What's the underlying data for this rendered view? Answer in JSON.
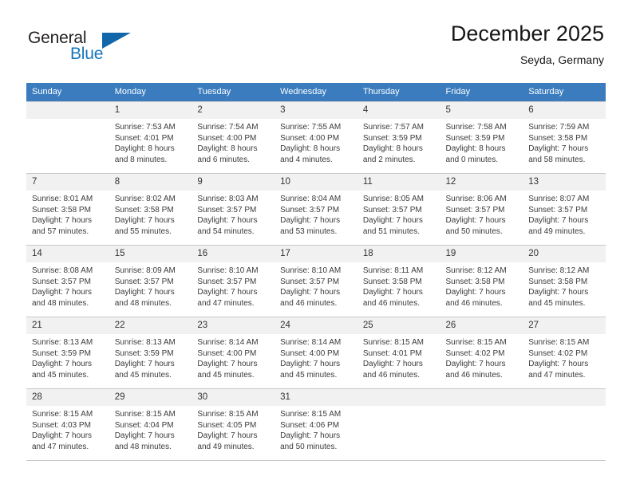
{
  "brand": {
    "name_part1": "General",
    "name_part2": "Blue",
    "triangle_icon": "triangle-icon",
    "color_dark": "#231f20",
    "color_blue": "#1476bc"
  },
  "header": {
    "title": "December 2025",
    "subtitle": "Seyda, Germany"
  },
  "theme": {
    "header_bg": "#3a7cbe",
    "daynum_bg": "#f1f1f1",
    "grid_line": "#c8c8c8",
    "text": "#3b3b3b"
  },
  "weekdays": [
    "Sunday",
    "Monday",
    "Tuesday",
    "Wednesday",
    "Thursday",
    "Friday",
    "Saturday"
  ],
  "weeks": [
    [
      {
        "day": "",
        "empty": true,
        "sunrise": "",
        "sunset": "",
        "daylight_line1": "",
        "daylight_line2": ""
      },
      {
        "day": "1",
        "sunrise": "Sunrise: 7:53 AM",
        "sunset": "Sunset: 4:01 PM",
        "daylight_line1": "Daylight: 8 hours",
        "daylight_line2": "and 8 minutes."
      },
      {
        "day": "2",
        "sunrise": "Sunrise: 7:54 AM",
        "sunset": "Sunset: 4:00 PM",
        "daylight_line1": "Daylight: 8 hours",
        "daylight_line2": "and 6 minutes."
      },
      {
        "day": "3",
        "sunrise": "Sunrise: 7:55 AM",
        "sunset": "Sunset: 4:00 PM",
        "daylight_line1": "Daylight: 8 hours",
        "daylight_line2": "and 4 minutes."
      },
      {
        "day": "4",
        "sunrise": "Sunrise: 7:57 AM",
        "sunset": "Sunset: 3:59 PM",
        "daylight_line1": "Daylight: 8 hours",
        "daylight_line2": "and 2 minutes."
      },
      {
        "day": "5",
        "sunrise": "Sunrise: 7:58 AM",
        "sunset": "Sunset: 3:59 PM",
        "daylight_line1": "Daylight: 8 hours",
        "daylight_line2": "and 0 minutes."
      },
      {
        "day": "6",
        "sunrise": "Sunrise: 7:59 AM",
        "sunset": "Sunset: 3:58 PM",
        "daylight_line1": "Daylight: 7 hours",
        "daylight_line2": "and 58 minutes."
      }
    ],
    [
      {
        "day": "7",
        "sunrise": "Sunrise: 8:01 AM",
        "sunset": "Sunset: 3:58 PM",
        "daylight_line1": "Daylight: 7 hours",
        "daylight_line2": "and 57 minutes."
      },
      {
        "day": "8",
        "sunrise": "Sunrise: 8:02 AM",
        "sunset": "Sunset: 3:58 PM",
        "daylight_line1": "Daylight: 7 hours",
        "daylight_line2": "and 55 minutes."
      },
      {
        "day": "9",
        "sunrise": "Sunrise: 8:03 AM",
        "sunset": "Sunset: 3:57 PM",
        "daylight_line1": "Daylight: 7 hours",
        "daylight_line2": "and 54 minutes."
      },
      {
        "day": "10",
        "sunrise": "Sunrise: 8:04 AM",
        "sunset": "Sunset: 3:57 PM",
        "daylight_line1": "Daylight: 7 hours",
        "daylight_line2": "and 53 minutes."
      },
      {
        "day": "11",
        "sunrise": "Sunrise: 8:05 AM",
        "sunset": "Sunset: 3:57 PM",
        "daylight_line1": "Daylight: 7 hours",
        "daylight_line2": "and 51 minutes."
      },
      {
        "day": "12",
        "sunrise": "Sunrise: 8:06 AM",
        "sunset": "Sunset: 3:57 PM",
        "daylight_line1": "Daylight: 7 hours",
        "daylight_line2": "and 50 minutes."
      },
      {
        "day": "13",
        "sunrise": "Sunrise: 8:07 AM",
        "sunset": "Sunset: 3:57 PM",
        "daylight_line1": "Daylight: 7 hours",
        "daylight_line2": "and 49 minutes."
      }
    ],
    [
      {
        "day": "14",
        "sunrise": "Sunrise: 8:08 AM",
        "sunset": "Sunset: 3:57 PM",
        "daylight_line1": "Daylight: 7 hours",
        "daylight_line2": "and 48 minutes."
      },
      {
        "day": "15",
        "sunrise": "Sunrise: 8:09 AM",
        "sunset": "Sunset: 3:57 PM",
        "daylight_line1": "Daylight: 7 hours",
        "daylight_line2": "and 48 minutes."
      },
      {
        "day": "16",
        "sunrise": "Sunrise: 8:10 AM",
        "sunset": "Sunset: 3:57 PM",
        "daylight_line1": "Daylight: 7 hours",
        "daylight_line2": "and 47 minutes."
      },
      {
        "day": "17",
        "sunrise": "Sunrise: 8:10 AM",
        "sunset": "Sunset: 3:57 PM",
        "daylight_line1": "Daylight: 7 hours",
        "daylight_line2": "and 46 minutes."
      },
      {
        "day": "18",
        "sunrise": "Sunrise: 8:11 AM",
        "sunset": "Sunset: 3:58 PM",
        "daylight_line1": "Daylight: 7 hours",
        "daylight_line2": "and 46 minutes."
      },
      {
        "day": "19",
        "sunrise": "Sunrise: 8:12 AM",
        "sunset": "Sunset: 3:58 PM",
        "daylight_line1": "Daylight: 7 hours",
        "daylight_line2": "and 46 minutes."
      },
      {
        "day": "20",
        "sunrise": "Sunrise: 8:12 AM",
        "sunset": "Sunset: 3:58 PM",
        "daylight_line1": "Daylight: 7 hours",
        "daylight_line2": "and 45 minutes."
      }
    ],
    [
      {
        "day": "21",
        "sunrise": "Sunrise: 8:13 AM",
        "sunset": "Sunset: 3:59 PM",
        "daylight_line1": "Daylight: 7 hours",
        "daylight_line2": "and 45 minutes."
      },
      {
        "day": "22",
        "sunrise": "Sunrise: 8:13 AM",
        "sunset": "Sunset: 3:59 PM",
        "daylight_line1": "Daylight: 7 hours",
        "daylight_line2": "and 45 minutes."
      },
      {
        "day": "23",
        "sunrise": "Sunrise: 8:14 AM",
        "sunset": "Sunset: 4:00 PM",
        "daylight_line1": "Daylight: 7 hours",
        "daylight_line2": "and 45 minutes."
      },
      {
        "day": "24",
        "sunrise": "Sunrise: 8:14 AM",
        "sunset": "Sunset: 4:00 PM",
        "daylight_line1": "Daylight: 7 hours",
        "daylight_line2": "and 45 minutes."
      },
      {
        "day": "25",
        "sunrise": "Sunrise: 8:15 AM",
        "sunset": "Sunset: 4:01 PM",
        "daylight_line1": "Daylight: 7 hours",
        "daylight_line2": "and 46 minutes."
      },
      {
        "day": "26",
        "sunrise": "Sunrise: 8:15 AM",
        "sunset": "Sunset: 4:02 PM",
        "daylight_line1": "Daylight: 7 hours",
        "daylight_line2": "and 46 minutes."
      },
      {
        "day": "27",
        "sunrise": "Sunrise: 8:15 AM",
        "sunset": "Sunset: 4:02 PM",
        "daylight_line1": "Daylight: 7 hours",
        "daylight_line2": "and 47 minutes."
      }
    ],
    [
      {
        "day": "28",
        "sunrise": "Sunrise: 8:15 AM",
        "sunset": "Sunset: 4:03 PM",
        "daylight_line1": "Daylight: 7 hours",
        "daylight_line2": "and 47 minutes."
      },
      {
        "day": "29",
        "sunrise": "Sunrise: 8:15 AM",
        "sunset": "Sunset: 4:04 PM",
        "daylight_line1": "Daylight: 7 hours",
        "daylight_line2": "and 48 minutes."
      },
      {
        "day": "30",
        "sunrise": "Sunrise: 8:15 AM",
        "sunset": "Sunset: 4:05 PM",
        "daylight_line1": "Daylight: 7 hours",
        "daylight_line2": "and 49 minutes."
      },
      {
        "day": "31",
        "sunrise": "Sunrise: 8:15 AM",
        "sunset": "Sunset: 4:06 PM",
        "daylight_line1": "Daylight: 7 hours",
        "daylight_line2": "and 50 minutes."
      },
      {
        "day": "",
        "empty": true,
        "sunrise": "",
        "sunset": "",
        "daylight_line1": "",
        "daylight_line2": ""
      },
      {
        "day": "",
        "empty": true,
        "sunrise": "",
        "sunset": "",
        "daylight_line1": "",
        "daylight_line2": ""
      },
      {
        "day": "",
        "empty": true,
        "sunrise": "",
        "sunset": "",
        "daylight_line1": "",
        "daylight_line2": ""
      }
    ]
  ]
}
